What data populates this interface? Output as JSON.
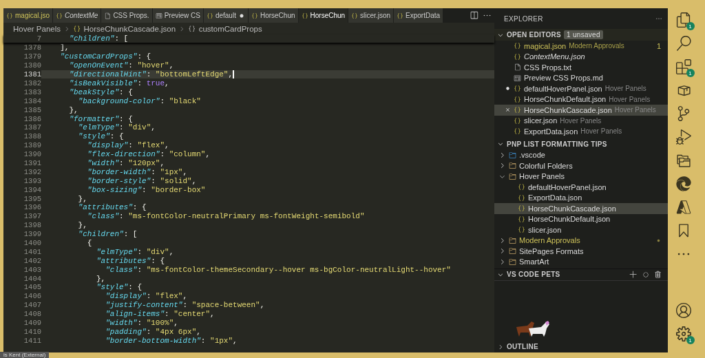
{
  "tabs": [
    {
      "label": "magical.jso",
      "kind": "json",
      "selected": false,
      "italic": false,
      "warning": true,
      "dirty": false
    },
    {
      "label": "ContextMe",
      "kind": "json",
      "selected": false,
      "italic": true,
      "warning": false,
      "dirty": false
    },
    {
      "label": "CSS Props.",
      "kind": "txt",
      "selected": false,
      "italic": false,
      "warning": false,
      "dirty": false
    },
    {
      "label": "Preview CS",
      "kind": "md",
      "selected": false,
      "italic": false,
      "warning": false,
      "dirty": false
    },
    {
      "label": "default",
      "kind": "json",
      "selected": false,
      "italic": false,
      "warning": false,
      "dirty": true
    },
    {
      "label": "HorseChun",
      "kind": "json",
      "selected": false,
      "italic": false,
      "warning": false,
      "dirty": false
    },
    {
      "label": "HorseChun",
      "kind": "json",
      "selected": true,
      "italic": false,
      "warning": false,
      "dirty": false
    },
    {
      "label": "slicer.json",
      "kind": "json",
      "selected": false,
      "italic": false,
      "warning": false,
      "dirty": false
    },
    {
      "label": "ExportData",
      "kind": "json",
      "selected": false,
      "italic": false,
      "warning": false,
      "dirty": false
    }
  ],
  "breadcrumb": [
    "Hover Panels",
    "HorseChunkCascade.json",
    "customCardProps"
  ],
  "sticky_line": {
    "n": "7",
    "tokens": [
      {
        "kind": "key",
        "text": "    \"children\""
      },
      {
        "kind": "punct",
        "text": ": ["
      }
    ]
  },
  "lines": [
    {
      "n": "1378",
      "current": false,
      "tokens": [
        {
          "kind": "punct",
          "text": "  ],"
        }
      ]
    },
    {
      "n": "1379",
      "current": false,
      "tokens": [
        {
          "kind": "key",
          "text": "  \"customCardProps\""
        },
        {
          "kind": "punct",
          "text": ": {"
        }
      ]
    },
    {
      "n": "1380",
      "current": false,
      "tokens": [
        {
          "kind": "key",
          "text": "    \"openOnEvent\""
        },
        {
          "kind": "punct",
          "text": ": "
        },
        {
          "kind": "string",
          "text": "\"hover\""
        },
        {
          "kind": "punct",
          "text": ","
        }
      ]
    },
    {
      "n": "1381",
      "current": true,
      "tokens": [
        {
          "kind": "key",
          "text": "    \"directionalHint\""
        },
        {
          "kind": "punct",
          "text": ": "
        },
        {
          "kind": "string",
          "text": "\"bottomLeftEdge\""
        },
        {
          "kind": "punct",
          "text": ","
        }
      ]
    },
    {
      "n": "1382",
      "current": false,
      "tokens": [
        {
          "kind": "key",
          "text": "    \"isBeakVisible\""
        },
        {
          "kind": "punct",
          "text": ": "
        },
        {
          "kind": "bool",
          "text": "true"
        },
        {
          "kind": "punct",
          "text": ","
        }
      ]
    },
    {
      "n": "1383",
      "current": false,
      "tokens": [
        {
          "kind": "key",
          "text": "    \"beakStyle\""
        },
        {
          "kind": "punct",
          "text": ": {"
        }
      ]
    },
    {
      "n": "1384",
      "current": false,
      "tokens": [
        {
          "kind": "key",
          "text": "      \"background-color\""
        },
        {
          "kind": "punct",
          "text": ": "
        },
        {
          "kind": "string",
          "text": "\"black\""
        }
      ]
    },
    {
      "n": "1385",
      "current": false,
      "tokens": [
        {
          "kind": "punct",
          "text": "    },"
        }
      ]
    },
    {
      "n": "1386",
      "current": false,
      "tokens": [
        {
          "kind": "key",
          "text": "    \"formatter\""
        },
        {
          "kind": "punct",
          "text": ": {"
        }
      ]
    },
    {
      "n": "1387",
      "current": false,
      "tokens": [
        {
          "kind": "key",
          "text": "      \"elmType\""
        },
        {
          "kind": "punct",
          "text": ": "
        },
        {
          "kind": "string",
          "text": "\"div\""
        },
        {
          "kind": "punct",
          "text": ","
        }
      ]
    },
    {
      "n": "1388",
      "current": false,
      "tokens": [
        {
          "kind": "key",
          "text": "      \"style\""
        },
        {
          "kind": "punct",
          "text": ": {"
        }
      ]
    },
    {
      "n": "1389",
      "current": false,
      "tokens": [
        {
          "kind": "key",
          "text": "        \"display\""
        },
        {
          "kind": "punct",
          "text": ": "
        },
        {
          "kind": "string",
          "text": "\"flex\""
        },
        {
          "kind": "punct",
          "text": ","
        }
      ]
    },
    {
      "n": "1390",
      "current": false,
      "tokens": [
        {
          "kind": "key",
          "text": "        \"flex-direction\""
        },
        {
          "kind": "punct",
          "text": ": "
        },
        {
          "kind": "string",
          "text": "\"column\""
        },
        {
          "kind": "punct",
          "text": ","
        }
      ]
    },
    {
      "n": "1391",
      "current": false,
      "tokens": [
        {
          "kind": "key",
          "text": "        \"width\""
        },
        {
          "kind": "punct",
          "text": ": "
        },
        {
          "kind": "string",
          "text": "\"120px\""
        },
        {
          "kind": "punct",
          "text": ","
        }
      ]
    },
    {
      "n": "1392",
      "current": false,
      "tokens": [
        {
          "kind": "key",
          "text": "        \"border-width\""
        },
        {
          "kind": "punct",
          "text": ": "
        },
        {
          "kind": "string",
          "text": "\"1px\""
        },
        {
          "kind": "punct",
          "text": ","
        }
      ]
    },
    {
      "n": "1393",
      "current": false,
      "tokens": [
        {
          "kind": "key",
          "text": "        \"border-style\""
        },
        {
          "kind": "punct",
          "text": ": "
        },
        {
          "kind": "string",
          "text": "\"solid\""
        },
        {
          "kind": "punct",
          "text": ","
        }
      ]
    },
    {
      "n": "1394",
      "current": false,
      "tokens": [
        {
          "kind": "key",
          "text": "        \"box-sizing\""
        },
        {
          "kind": "punct",
          "text": ": "
        },
        {
          "kind": "string",
          "text": "\"border-box\""
        }
      ]
    },
    {
      "n": "1395",
      "current": false,
      "tokens": [
        {
          "kind": "punct",
          "text": "      },"
        }
      ]
    },
    {
      "n": "1396",
      "current": false,
      "tokens": [
        {
          "kind": "key",
          "text": "      \"attributes\""
        },
        {
          "kind": "punct",
          "text": ": {"
        }
      ]
    },
    {
      "n": "1397",
      "current": false,
      "tokens": [
        {
          "kind": "key",
          "text": "        \"class\""
        },
        {
          "kind": "punct",
          "text": ": "
        },
        {
          "kind": "string",
          "text": "\"ms-fontColor-neutralPrimary ms-fontWeight-semibold\""
        }
      ]
    },
    {
      "n": "1398",
      "current": false,
      "tokens": [
        {
          "kind": "punct",
          "text": "      },"
        }
      ]
    },
    {
      "n": "1399",
      "current": false,
      "tokens": [
        {
          "kind": "key",
          "text": "      \"children\""
        },
        {
          "kind": "punct",
          "text": ": ["
        }
      ]
    },
    {
      "n": "1400",
      "current": false,
      "tokens": [
        {
          "kind": "punct",
          "text": "        {"
        }
      ]
    },
    {
      "n": "1401",
      "current": false,
      "tokens": [
        {
          "kind": "key",
          "text": "          \"elmType\""
        },
        {
          "kind": "punct",
          "text": ": "
        },
        {
          "kind": "string",
          "text": "\"div\""
        },
        {
          "kind": "punct",
          "text": ","
        }
      ]
    },
    {
      "n": "1402",
      "current": false,
      "tokens": [
        {
          "kind": "key",
          "text": "          \"attributes\""
        },
        {
          "kind": "punct",
          "text": ": {"
        }
      ]
    },
    {
      "n": "1403",
      "current": false,
      "tokens": [
        {
          "kind": "key",
          "text": "            \"class\""
        },
        {
          "kind": "punct",
          "text": ": "
        },
        {
          "kind": "string",
          "text": "\"ms-fontColor-themeSecondary--hover ms-bgColor-neutralLight--hover\""
        }
      ]
    },
    {
      "n": "1404",
      "current": false,
      "tokens": [
        {
          "kind": "punct",
          "text": "          },"
        }
      ]
    },
    {
      "n": "1405",
      "current": false,
      "tokens": [
        {
          "kind": "key",
          "text": "          \"style\""
        },
        {
          "kind": "punct",
          "text": ": {"
        }
      ]
    },
    {
      "n": "1406",
      "current": false,
      "tokens": [
        {
          "kind": "key",
          "text": "            \"display\""
        },
        {
          "kind": "punct",
          "text": ": "
        },
        {
          "kind": "string",
          "text": "\"flex\""
        },
        {
          "kind": "punct",
          "text": ","
        }
      ]
    },
    {
      "n": "1407",
      "current": false,
      "tokens": [
        {
          "kind": "key",
          "text": "            \"justify-content\""
        },
        {
          "kind": "punct",
          "text": ": "
        },
        {
          "kind": "string",
          "text": "\"space-between\""
        },
        {
          "kind": "punct",
          "text": ","
        }
      ]
    },
    {
      "n": "1408",
      "current": false,
      "tokens": [
        {
          "kind": "key",
          "text": "            \"align-items\""
        },
        {
          "kind": "punct",
          "text": ": "
        },
        {
          "kind": "string",
          "text": "\"center\""
        },
        {
          "kind": "punct",
          "text": ","
        }
      ]
    },
    {
      "n": "1409",
      "current": false,
      "tokens": [
        {
          "kind": "key",
          "text": "            \"width\""
        },
        {
          "kind": "punct",
          "text": ": "
        },
        {
          "kind": "string",
          "text": "\"100%\""
        },
        {
          "kind": "punct",
          "text": ","
        }
      ]
    },
    {
      "n": "1410",
      "current": false,
      "tokens": [
        {
          "kind": "key",
          "text": "            \"padding\""
        },
        {
          "kind": "punct",
          "text": ": "
        },
        {
          "kind": "string",
          "text": "\"4px 6px\""
        },
        {
          "kind": "punct",
          "text": ","
        }
      ]
    },
    {
      "n": "1411",
      "current": false,
      "tokens": [
        {
          "kind": "key",
          "text": "            \"border-bottom-width\""
        },
        {
          "kind": "punct",
          "text": ": "
        },
        {
          "kind": "string",
          "text": "\"1px\""
        },
        {
          "kind": "punct",
          "text": ","
        }
      ]
    }
  ],
  "terminal_tab": "is Kent (External)",
  "explorer": {
    "title": "EXPLORER",
    "open_editors": {
      "title": "OPEN EDITORS",
      "badge": "1 unsaved",
      "items": [
        {
          "name": "magical.json",
          "folder": "Modern Approvals",
          "kind": "json",
          "italic": false,
          "warning": true,
          "dirty": false,
          "selected": false,
          "count": "1"
        },
        {
          "name": "ContextMenu.json",
          "kind": "json",
          "italic": true,
          "warning": false,
          "dirty": false,
          "selected": false
        },
        {
          "name": "CSS Props.txt",
          "kind": "txt",
          "italic": false,
          "warning": false,
          "dirty": false,
          "selected": false
        },
        {
          "name": "Preview CSS Props.md",
          "kind": "md",
          "italic": false,
          "warning": false,
          "dirty": false,
          "selected": false
        },
        {
          "name": "defaultHoverPanel.json",
          "folder": "Hover Panels",
          "kind": "json",
          "italic": false,
          "warning": false,
          "dirty": true,
          "selected": false
        },
        {
          "name": "HorseChunkDefault.json",
          "folder": "Hover Panels",
          "kind": "json",
          "italic": false,
          "warning": false,
          "dirty": false,
          "selected": false
        },
        {
          "name": "HorseChunkCascade.json",
          "folder": "Hover Panels",
          "kind": "json",
          "italic": false,
          "warning": false,
          "dirty": false,
          "selected": true
        },
        {
          "name": "slicer.json",
          "folder": "Hover Panels",
          "kind": "json",
          "italic": false,
          "warning": false,
          "dirty": false,
          "selected": false
        },
        {
          "name": "ExportData.json",
          "folder": "Hover Panels",
          "kind": "json",
          "italic": false,
          "warning": false,
          "dirty": false,
          "selected": false
        }
      ]
    },
    "project": {
      "title": "PNP LIST FORMATTING TIPS",
      "tree": [
        {
          "name": ".vscode",
          "kind": "vscode-folder",
          "expanded": false,
          "selected": false,
          "warning": false
        },
        {
          "name": "Colorful Folders",
          "kind": "folder",
          "expanded": false,
          "selected": false,
          "warning": false
        },
        {
          "name": "Hover Panels",
          "kind": "folder",
          "expanded": true,
          "selected": false,
          "warning": false,
          "children": [
            {
              "name": "defaultHoverPanel.json",
              "kind": "json",
              "selected": false,
              "warning": false
            },
            {
              "name": "ExportData.json",
              "kind": "json",
              "selected": false,
              "warning": false
            },
            {
              "name": "HorseChunkCascade.json",
              "kind": "json",
              "selected": true,
              "warning": false
            },
            {
              "name": "HorseChunkDefault.json",
              "kind": "json",
              "selected": false,
              "warning": false
            },
            {
              "name": "slicer.json",
              "kind": "json",
              "selected": false,
              "warning": false
            }
          ]
        },
        {
          "name": "Modern Approvals",
          "kind": "folder",
          "expanded": false,
          "selected": false,
          "warning": true
        },
        {
          "name": "SitePages Formats",
          "kind": "folder",
          "expanded": false,
          "selected": false,
          "warning": false
        },
        {
          "name": "SmartArt",
          "kind": "folder",
          "expanded": false,
          "selected": false,
          "warning": false
        }
      ]
    },
    "pets": {
      "title": "VS CODE PETS"
    },
    "outline": {
      "title": "OUTLINE"
    }
  },
  "activity_bar": [
    {
      "kind": "files",
      "badge": "1"
    },
    {
      "kind": "search"
    },
    {
      "kind": "extensions",
      "badge": "1"
    },
    {
      "kind": "box"
    },
    {
      "kind": "git"
    },
    {
      "kind": "debug"
    },
    {
      "kind": "folders"
    },
    {
      "kind": "edge"
    },
    {
      "kind": "azure"
    },
    {
      "kind": "bookmark"
    },
    {
      "kind": "more"
    },
    {
      "kind": "account"
    },
    {
      "kind": "settings",
      "badge": "1"
    }
  ]
}
